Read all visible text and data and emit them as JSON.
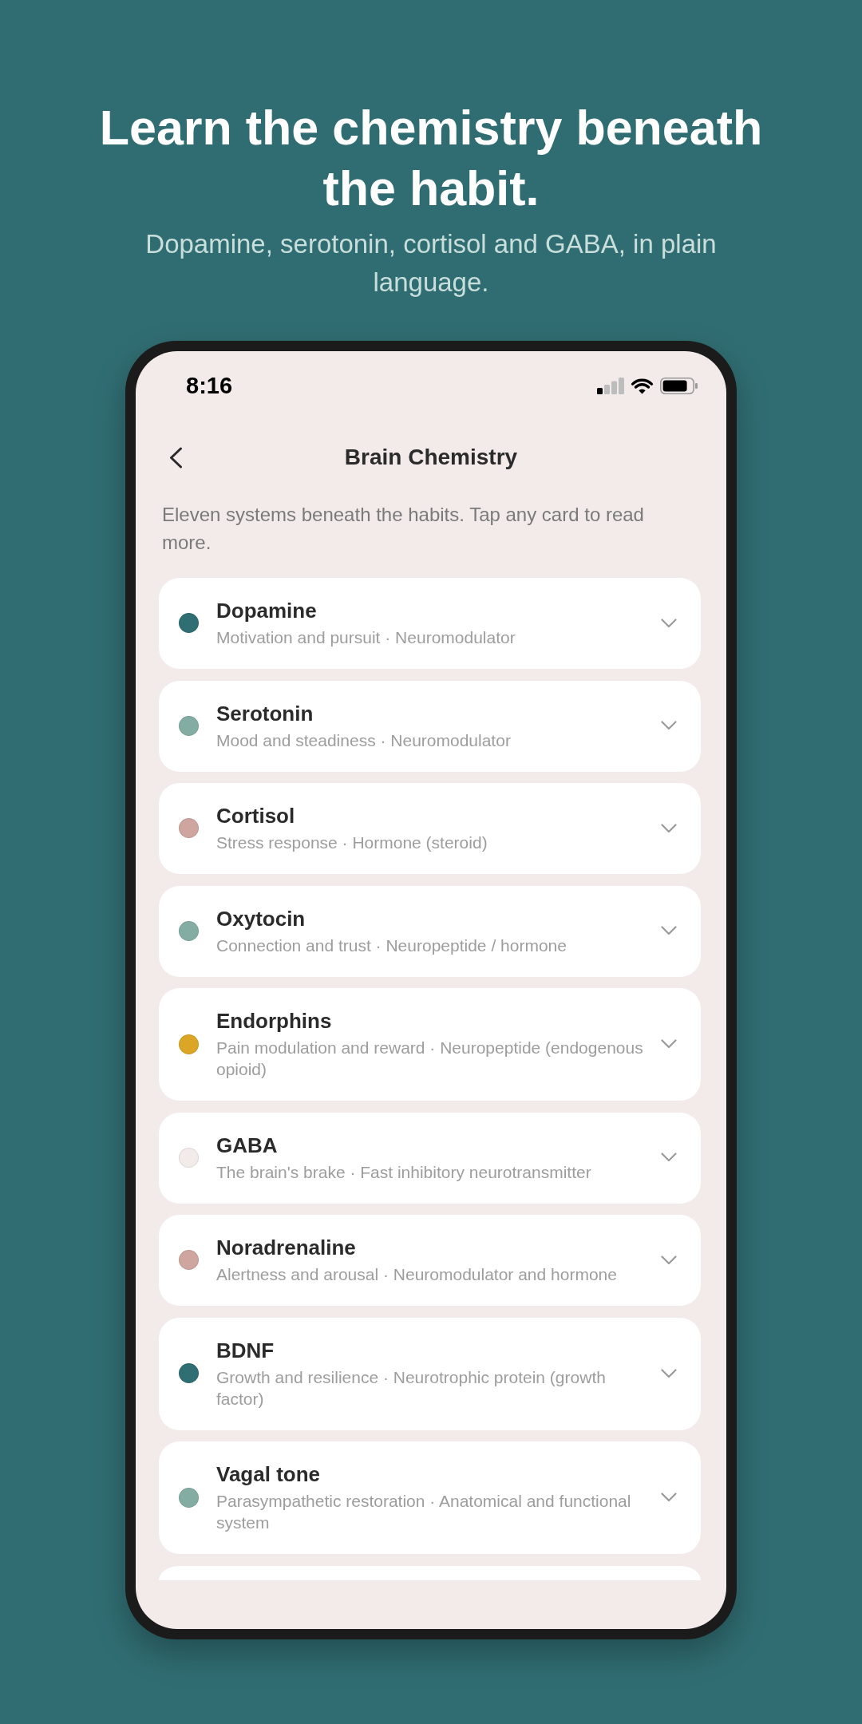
{
  "headline": {
    "title": "Learn the chemistry beneath the habit.",
    "subtitle": "Dopamine, serotonin, cortisol and GABA, in plain language."
  },
  "status_bar": {
    "time": "8:16"
  },
  "nav": {
    "title": "Brain Chemistry"
  },
  "intro": "Eleven systems beneath the habits. Tap any card to read more.",
  "systems": [
    {
      "name": "Dopamine",
      "summary": "Motivation and pursuit · Neuromodulator",
      "color": "#2f6e72",
      "expanded": false
    },
    {
      "name": "Serotonin",
      "summary": "Mood and steadiness · Neuromodulator",
      "color": "#83ada3",
      "expanded": false
    },
    {
      "name": "Cortisol",
      "summary": "Stress response · Hormone (steroid)",
      "color": "#cfa59f",
      "expanded": false
    },
    {
      "name": "Oxytocin",
      "summary": "Connection and trust · Neuropeptide / hormone",
      "color": "#83ada3",
      "expanded": false
    },
    {
      "name": "Endorphins",
      "summary": "Pain modulation and reward · Neuropeptide (endogenous opioid)",
      "color": "#dba626",
      "expanded": false
    },
    {
      "name": "GABA",
      "summary": "The brain's brake · Fast inhibitory neurotransmitter",
      "color": "#f3ebe9",
      "expanded": false
    },
    {
      "name": "Noradrenaline",
      "summary": "Alertness and arousal · Neuromodulator and hormone",
      "color": "#cfa59f",
      "expanded": false
    },
    {
      "name": "BDNF",
      "summary": "Growth and resilience · Neurotrophic protein (growth factor)",
      "color": "#2f6e72",
      "expanded": false
    },
    {
      "name": "Vagal tone",
      "summary": "Parasympathetic restoration · Anatomical and functional system",
      "color": "#83ada3",
      "expanded": false
    }
  ],
  "more_below": true
}
